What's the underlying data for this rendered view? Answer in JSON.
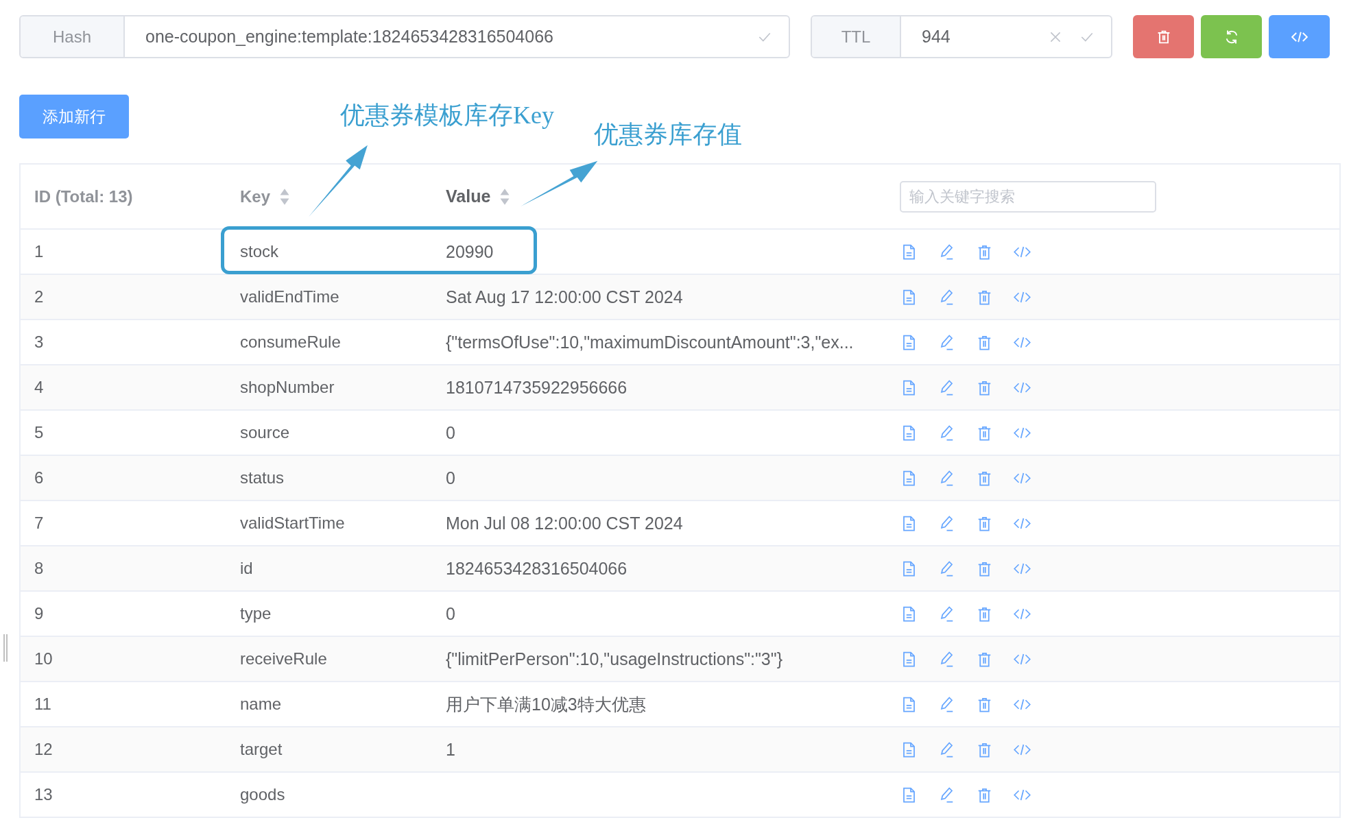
{
  "toolbar": {
    "hash_label": "Hash",
    "hash_value": "one-coupon_engine:template:1824653428316504066",
    "ttl_label": "TTL",
    "ttl_value": "944"
  },
  "add_button": "添加新行",
  "annotations": [
    {
      "text": "优惠券模板库存Key"
    },
    {
      "text": "优惠券库存值"
    }
  ],
  "table": {
    "columns": [
      "ID (Total: 13)",
      "Key",
      "Value"
    ],
    "search": {
      "placeholder": "输入关键字搜索"
    },
    "rows": [
      {
        "id": "1",
        "key": "stock",
        "value": "20990"
      },
      {
        "id": "2",
        "key": "validEndTime",
        "value": "Sat Aug 17 12:00:00 CST 2024"
      },
      {
        "id": "3",
        "key": "consumeRule",
        "value": "{\"termsOfUse\":10,\"maximumDiscountAmount\":3,\"ex..."
      },
      {
        "id": "4",
        "key": "shopNumber",
        "value": "1810714735922956666"
      },
      {
        "id": "5",
        "key": "source",
        "value": "0"
      },
      {
        "id": "6",
        "key": "status",
        "value": "0"
      },
      {
        "id": "7",
        "key": "validStartTime",
        "value": "Mon Jul 08 12:00:00 CST 2024"
      },
      {
        "id": "8",
        "key": "id",
        "value": "1824653428316504066"
      },
      {
        "id": "9",
        "key": "type",
        "value": "0"
      },
      {
        "id": "10",
        "key": "receiveRule",
        "value": "{\"limitPerPerson\":10,\"usageInstructions\":\"3\"}"
      },
      {
        "id": "11",
        "key": "name",
        "value": "用户下单满10减3特大优惠"
      },
      {
        "id": "12",
        "key": "target",
        "value": "1"
      },
      {
        "id": "13",
        "key": "goods"
      }
    ]
  }
}
